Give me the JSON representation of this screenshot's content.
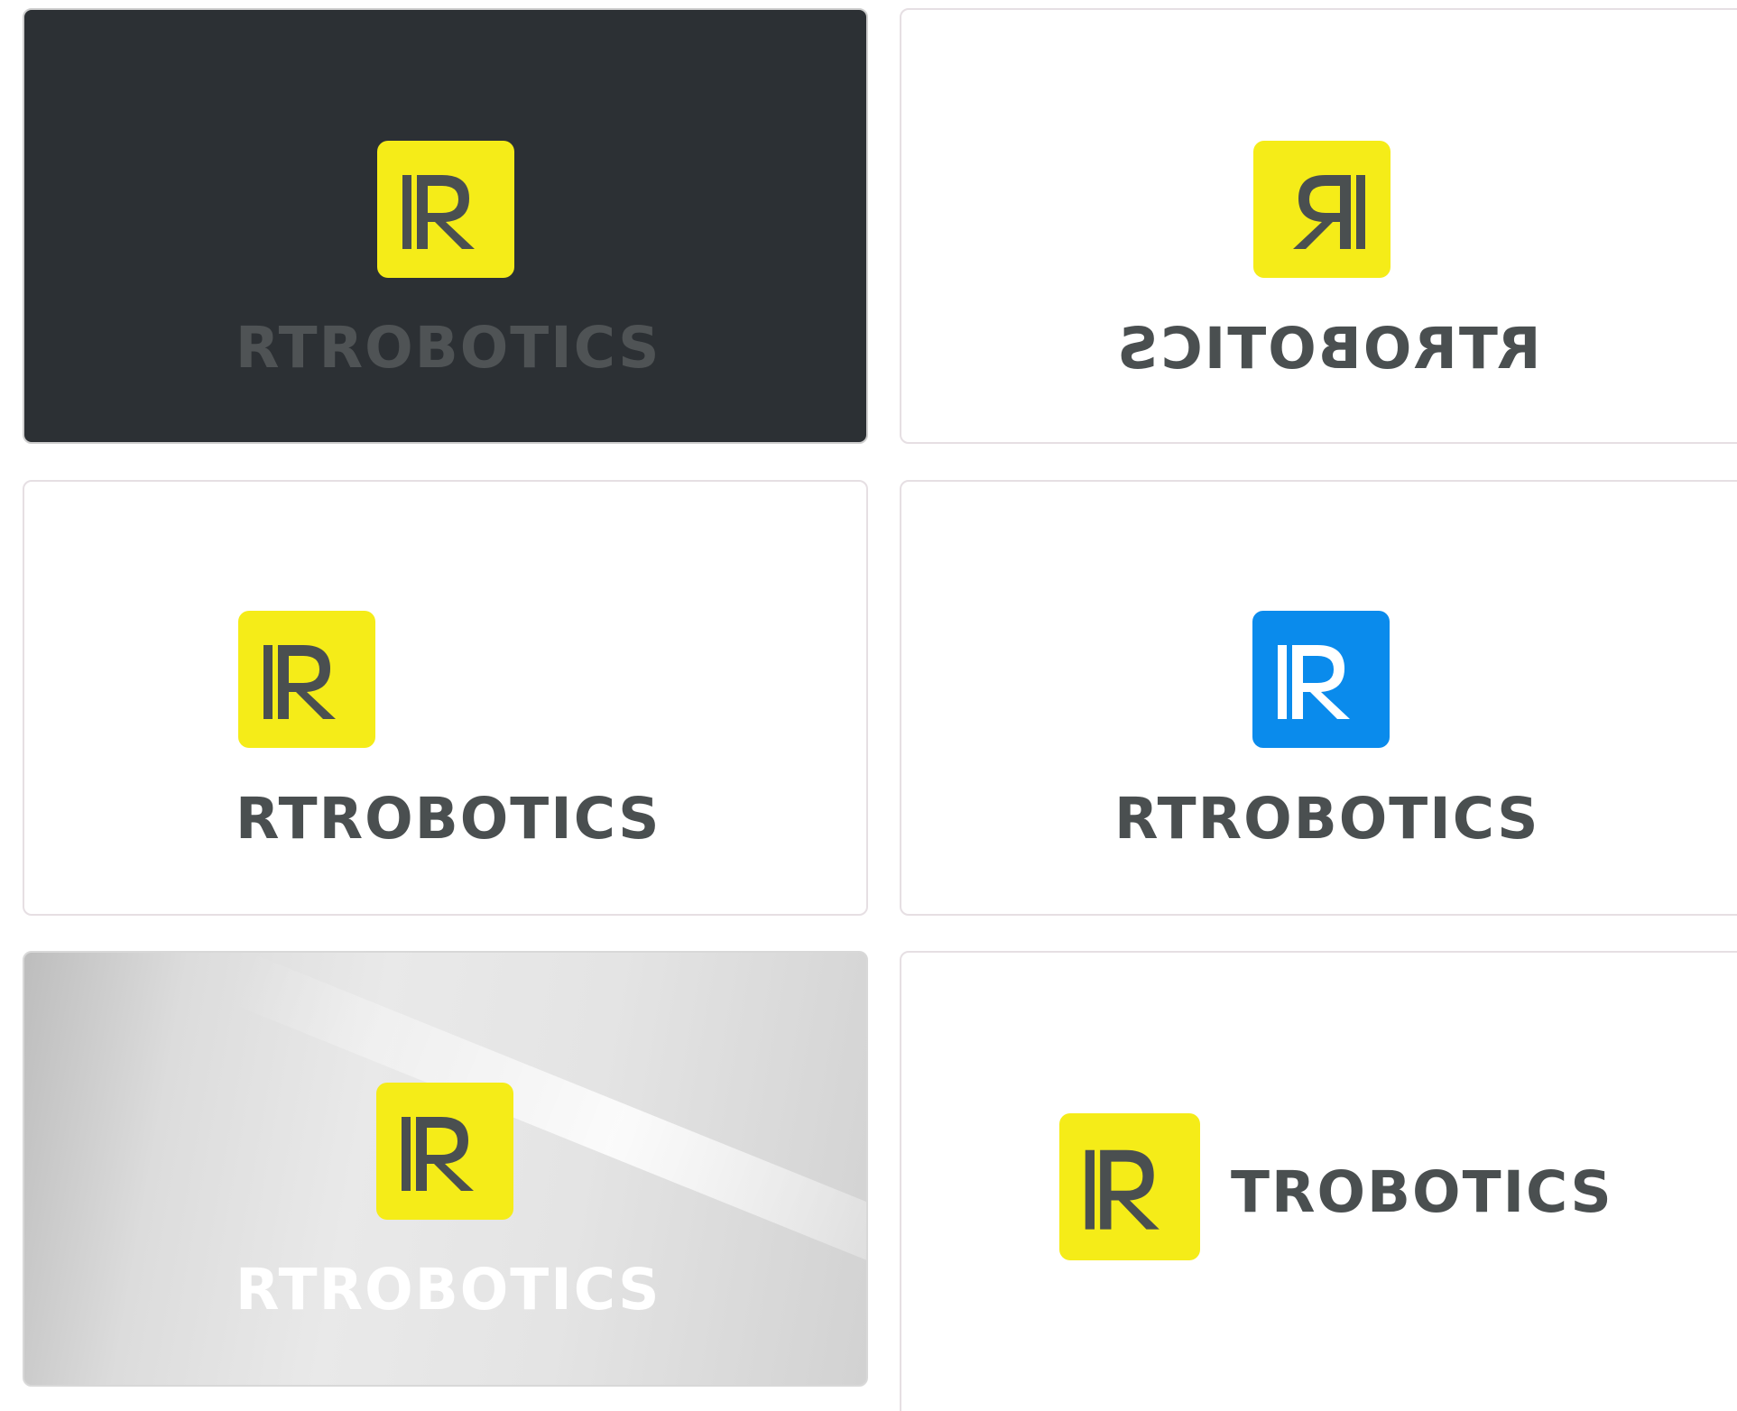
{
  "brand": {
    "name": "RTROBOTICS",
    "short_name": "TROBOTICS",
    "logo_letter": "R"
  },
  "colors": {
    "yellow": "#f5ec18",
    "blue": "#0a8bec",
    "charcoal": "#4a4f50",
    "dark_bg": "#2c3034",
    "dim_text": "#4f5355",
    "white": "#ffffff"
  },
  "variants": [
    {
      "label": "dark background, yellow mark, dim wordmark",
      "wordmark": "RTROBOTICS"
    },
    {
      "label": "mirrored",
      "wordmark": "RTROBOTICS"
    },
    {
      "label": "left aligned",
      "wordmark": "RTROBOTICS"
    },
    {
      "label": "blue mark",
      "wordmark": "RTROBOTICS"
    },
    {
      "label": "silver background, white wordmark",
      "wordmark": "RTROBOTICS"
    },
    {
      "label": "horizontal lockup",
      "wordmark": "TROBOTICS"
    }
  ]
}
